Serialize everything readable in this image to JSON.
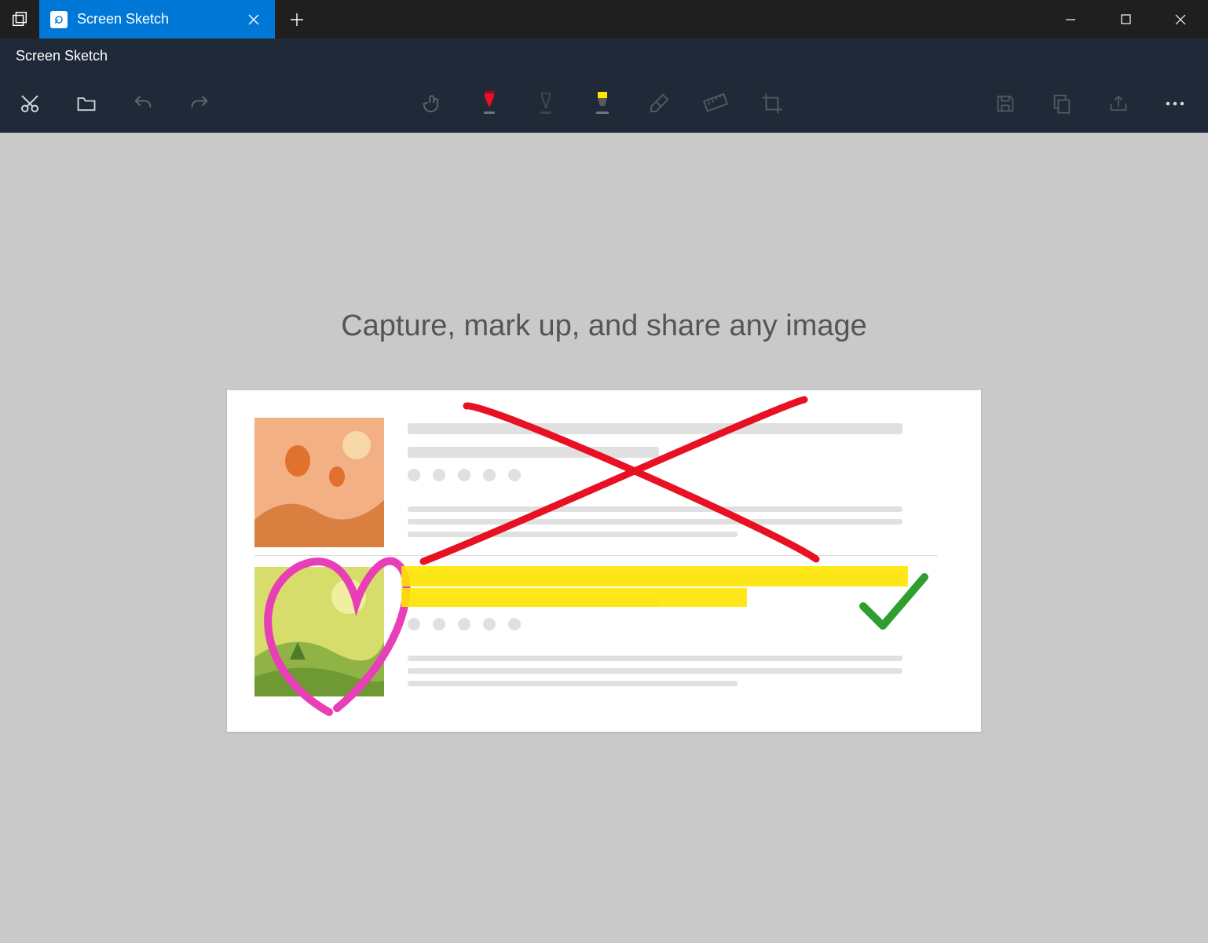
{
  "titlebar": {
    "tab_label": "Screen Sketch"
  },
  "subtitle": "Screen Sketch",
  "headline": "Capture, mark up, and share any image",
  "tools": {
    "new_snip": "New snip",
    "open": "Open file",
    "undo": "Undo",
    "redo": "Redo",
    "touch": "Touch writing",
    "pen": "Ballpoint pen",
    "pencil": "Pencil",
    "highlighter": "Highlighter",
    "eraser": "Eraser",
    "ruler": "Ruler",
    "crop": "Image crop",
    "save": "Save as",
    "copy": "Copy",
    "share": "Share",
    "more": "See more"
  },
  "colors": {
    "pen": "#e81123",
    "pencil": "#5d5a58",
    "highlighter": "#ffeb3b"
  }
}
